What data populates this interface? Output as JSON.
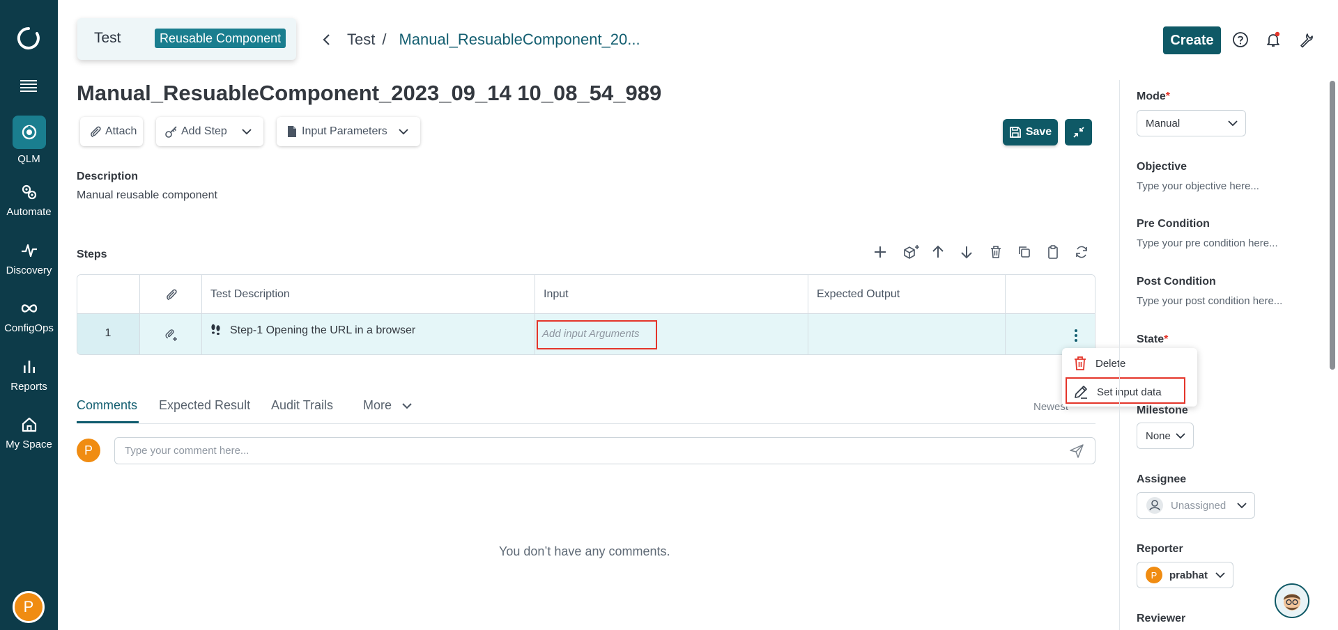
{
  "nav": {
    "items": [
      {
        "label": "QLM"
      },
      {
        "label": "Automate"
      },
      {
        "label": "Discovery"
      },
      {
        "label": "ConfigOps"
      },
      {
        "label": "Reports"
      },
      {
        "label": "My Space"
      }
    ],
    "user_initial": "P"
  },
  "context": {
    "title": "Test",
    "badge": "Reusable Component"
  },
  "breadcrumb": {
    "parent": "Test",
    "separator": "/",
    "current": "Manual_ResuableComponent_20..."
  },
  "topbar": {
    "create_label": "Create"
  },
  "page": {
    "title": "Manual_ResuableComponent_2023_09_14 10_08_54_989"
  },
  "toolbar": {
    "attach": "Attach",
    "add_step": "Add Step",
    "input_parameters": "Input Parameters",
    "save": "Save"
  },
  "description": {
    "label": "Description",
    "value": "Manual reusable component"
  },
  "steps": {
    "label": "Steps",
    "columns": [
      "Test Description",
      "Input",
      "Expected Output"
    ],
    "rows": [
      {
        "num": "1",
        "description": "Step-1 Opening the URL in a browser",
        "input_placeholder": "Add input Arguments",
        "expected": ""
      }
    ]
  },
  "row_menu": {
    "delete": "Delete",
    "set_input": "Set input data"
  },
  "tabs": {
    "items": [
      "Comments",
      "Expected Result",
      "Audit Trails",
      "More"
    ],
    "active": "Comments",
    "sort": "Newest"
  },
  "comments": {
    "user_initial": "P",
    "placeholder": "Type your comment here...",
    "empty": "You don’t have any comments."
  },
  "panel": {
    "mode": {
      "label": "Mode",
      "value": "Manual"
    },
    "objective": {
      "label": "Objective",
      "placeholder": "Type your objective here..."
    },
    "pre_condition": {
      "label": "Pre Condition",
      "placeholder": "Type your pre condition here..."
    },
    "post_condition": {
      "label": "Post Condition",
      "placeholder": "Type your post condition here..."
    },
    "state": {
      "label": "State"
    },
    "milestone": {
      "label": "Milestone",
      "value": "None"
    },
    "assignee": {
      "label": "Assignee",
      "value": "Unassigned"
    },
    "reporter": {
      "label": "Reporter",
      "value": "prabhat",
      "initial": "P"
    },
    "reviewer": {
      "label": "Reviewer"
    },
    "required_mark": "*"
  },
  "colors": {
    "rail": "#0d3b49",
    "accent": "#0f5966",
    "active_nav": "#1a7e8f",
    "highlight": "#e4352a",
    "avatar": "#f08c12",
    "row": "#e5f6f8"
  }
}
